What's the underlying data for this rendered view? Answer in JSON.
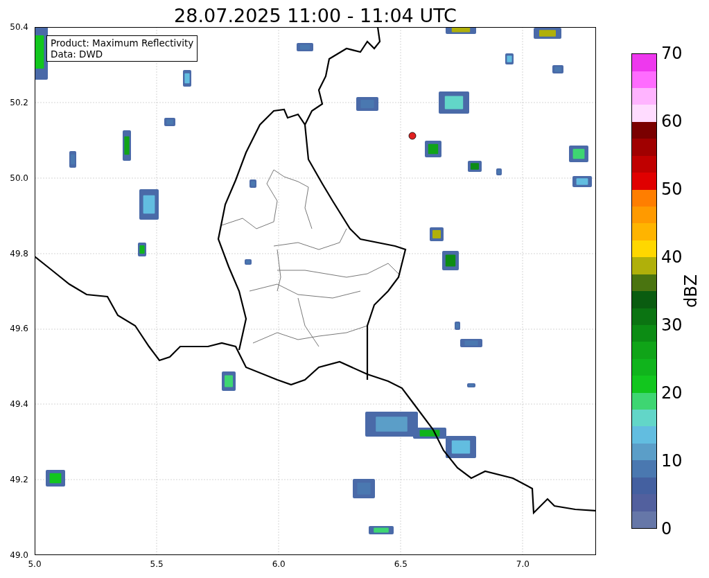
{
  "title": "28.07.2025 11:00 - 11:04 UTC",
  "info_box": {
    "lines": [
      "Product: Maximum Reflectivity",
      "Data: DWD"
    ]
  },
  "x_ticks": [
    "5.0",
    "5.5",
    "6.0",
    "6.5",
    "7.0"
  ],
  "y_ticks": [
    "50.4",
    "50.2",
    "50.0",
    "49.8",
    "49.6",
    "49.4",
    "49.2",
    "49.0"
  ],
  "colorbar": {
    "label": "dBZ",
    "ticks": [
      "70",
      "60",
      "50",
      "40",
      "30",
      "20",
      "10",
      "0"
    ],
    "bands": [
      {
        "color": "#6677a8"
      },
      {
        "color": "#52609e"
      },
      {
        "color": "#4460a0"
      },
      {
        "color": "#4a78b0"
      },
      {
        "color": "#5b9ec8"
      },
      {
        "color": "#62bde0"
      },
      {
        "color": "#62d6c8"
      },
      {
        "color": "#3ed672"
      },
      {
        "color": "#12c61e"
      },
      {
        "color": "#10b41c"
      },
      {
        "color": "#10a418"
      },
      {
        "color": "#0c8c14"
      },
      {
        "color": "#0b7412"
      },
      {
        "color": "#0a5c10"
      },
      {
        "color": "#4a7410"
      },
      {
        "color": "#b0b00a"
      },
      {
        "color": "#ffd700"
      },
      {
        "color": "#ffb400"
      },
      {
        "color": "#ff9a00"
      },
      {
        "color": "#ff7e00"
      },
      {
        "color": "#e00000"
      },
      {
        "color": "#c00000"
      },
      {
        "color": "#a00000"
      },
      {
        "color": "#7a0000"
      },
      {
        "color": "#ffdcff"
      },
      {
        "color": "#ffb4ff"
      },
      {
        "color": "#ff6cff"
      },
      {
        "color": "#ee38ee"
      }
    ]
  }
}
